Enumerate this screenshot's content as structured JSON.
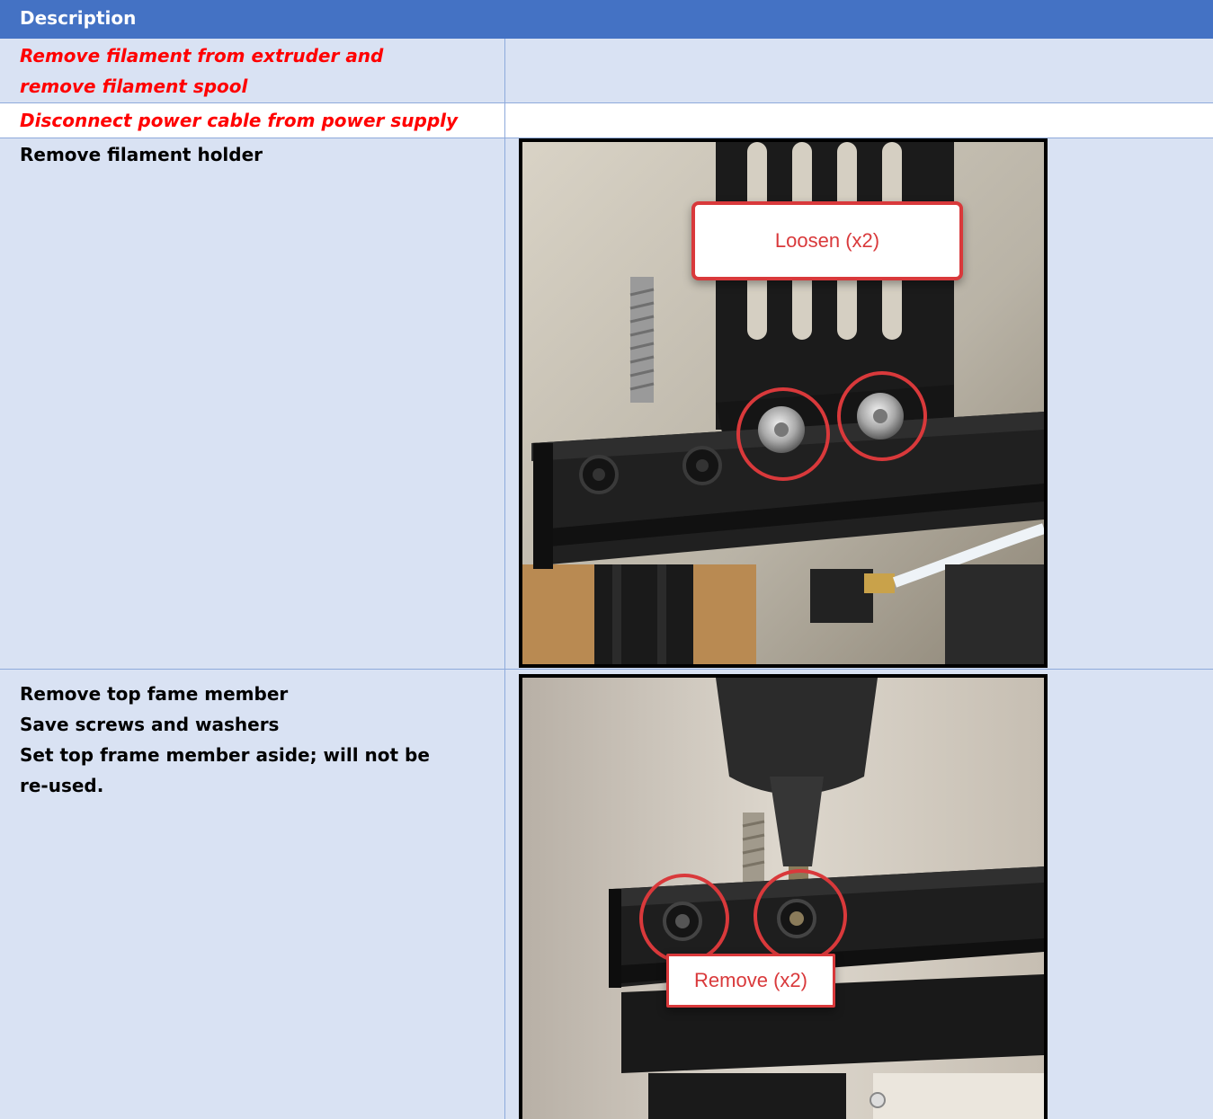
{
  "table": {
    "header": "Description",
    "rows": [
      {
        "text_lines": [
          "Remove filament from extruder and",
          "remove filament spool"
        ]
      },
      {
        "text_lines": [
          "Disconnect power cable from power supply"
        ]
      },
      {
        "text_lines": [
          "Remove filament holder"
        ],
        "callout": "Loosen (x2)"
      },
      {
        "text_lines": [
          "Remove top fame member",
          "Save screws and washers",
          "Set top frame member aside; will not be",
          "re-used."
        ],
        "callout": "Remove (x2)"
      }
    ]
  },
  "colors": {
    "header_bg": "#4472c4",
    "band_bg": "#d9e2f3",
    "warning_text": "#ff0000",
    "callout_red": "#d9393b"
  }
}
